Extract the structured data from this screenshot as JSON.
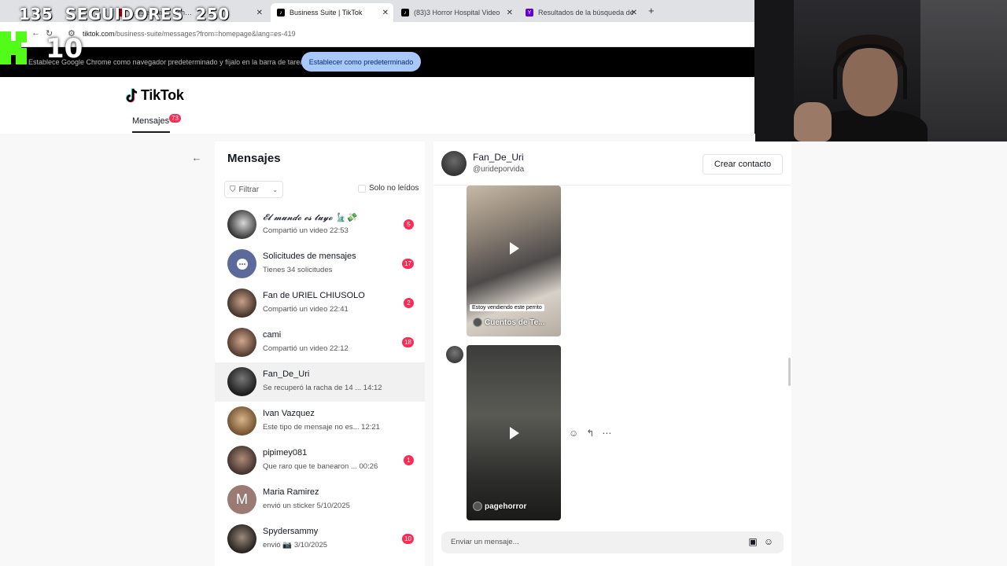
{
  "browser": {
    "tabs": [
      {
        "title": "…able …ad · Sch…",
        "active": false
      },
      {
        "title": "Business Suite | TikTok",
        "active": true
      },
      {
        "title": "(83)3 Horror Hospital Video",
        "active": false
      },
      {
        "title": "Resultados de la búsqueda de",
        "active": false
      }
    ],
    "new_tab": "+",
    "url_host": "tiktok.com",
    "url_path": "/business-suite/messages?from=homepage&lang=es-419",
    "infobar_text": "Establece Google Chrome como navegador predeterminado y fíjalo en la barra de tareas",
    "infobar_button": "Establecer como predeterminado"
  },
  "overlay": {
    "followers_current": "135",
    "followers_label": "SEGUIDORES",
    "followers_goal": "250",
    "counter": "10"
  },
  "tiktok": {
    "logo_text": "TikTok",
    "nav_tab": "Mensajes",
    "nav_badge": "73",
    "accent": "#fe2c55"
  },
  "messages_panel": {
    "title": "Mensajes",
    "filter_label": "Filtrar",
    "unread_only_label": "Solo no leídos",
    "conversations": [
      {
        "name": "𝓔𝓵 𝓶𝓾𝓷𝓭𝓸 𝓮𝓼 𝓽𝓾𝔂𝓸 🗽💸",
        "preview": "Compartió un video 22:53",
        "badge": "5"
      },
      {
        "name": "Solicitudes de mensajes",
        "preview": "Tienes 34 solicitudes",
        "badge": "17"
      },
      {
        "name": "Fan de URIEL CHIUSOLO",
        "preview": "Compartió un video 22:41",
        "badge": "2"
      },
      {
        "name": "cami",
        "preview": "Compartió un video 22:12",
        "badge": "18"
      },
      {
        "name": "Fan_De_Uri",
        "preview": "Se recuperó la racha de 14 ... 14:12",
        "badge": ""
      },
      {
        "name": "Ivan Vazquez",
        "preview": "Este tipo de mensaje no es... 12:21",
        "badge": ""
      },
      {
        "name": "pipimey081",
        "preview": "Que raro que te banearon ... 00:26",
        "badge": "1"
      },
      {
        "name": "Maria Ramirez",
        "preview": "envió un sticker 5/10/2025",
        "badge": "",
        "initial": "M"
      },
      {
        "name": "Spydersammy",
        "preview": "envió 📷 3/10/2025",
        "badge": "10"
      }
    ]
  },
  "chat": {
    "name": "Fan_De_Uri",
    "handle": "@urideporvida",
    "create_contact": "Crear contacto",
    "video1_caption": "Estoy vendiendo este perrito",
    "video1_author": "Cuentos de Te...",
    "video2_author": "pagehorror",
    "input_placeholder": "Enviar un mensaje..."
  }
}
